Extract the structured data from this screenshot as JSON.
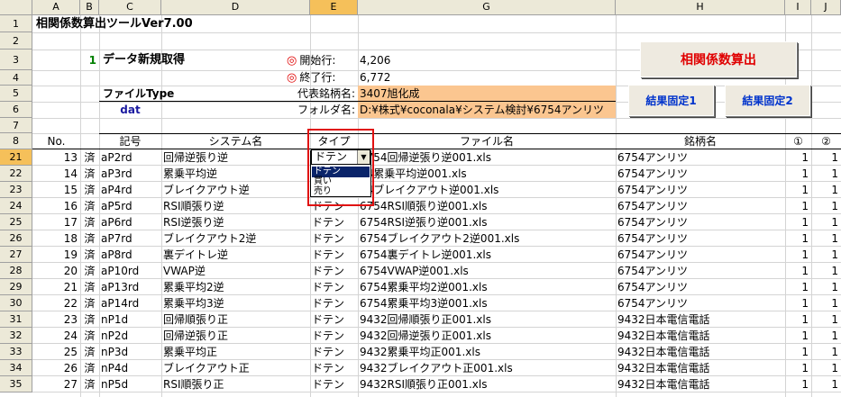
{
  "columns": [
    "A",
    "B",
    "C",
    "D",
    "E",
    "G",
    "H",
    "I",
    "J"
  ],
  "selected_column": "E",
  "title": "相関係数算出ツールVer7.00",
  "top_rows": [
    "1",
    "2",
    "3",
    "4",
    "5",
    "6",
    "7",
    "8"
  ],
  "data_row_numbers": [
    "21",
    "22",
    "23",
    "24",
    "25",
    "26",
    "27",
    "28",
    "29",
    "30",
    "31",
    "32",
    "33",
    "34",
    "35"
  ],
  "selected_row": "21",
  "step_number": "1",
  "data_refresh_label": "データ新規取得",
  "circle_mark": "◎",
  "start_row_label": "開始行:",
  "start_row_value": "4,206",
  "end_row_label": "終了行:",
  "end_row_value": "6,772",
  "file_type_label": "ファイルType",
  "file_type_value": "dat",
  "rep_stock_label": "代表銘柄名:",
  "rep_stock_value": "3407旭化成",
  "folder_label": "フォルダ名:",
  "folder_value": "D:¥株式¥coconala¥システム検討¥6754アンリツ",
  "buttons": {
    "calc": "相関係数算出",
    "fix1": "結果固定1",
    "fix2": "結果固定2"
  },
  "table_headers": {
    "no": "No.",
    "symbol": "記号",
    "system": "システム名",
    "type": "タイプ",
    "file": "ファイル名",
    "stock": "銘柄名",
    "c1": "①",
    "c2": "②"
  },
  "dropdown": {
    "value": "ドテン",
    "options": [
      "ドテン",
      "買い",
      "売り"
    ],
    "selected_index": 0
  },
  "rows": [
    {
      "no": "13",
      "b": "済",
      "sym": "aP2rd",
      "sys": "回帰逆張り逆",
      "type": "",
      "file": "6754回帰逆張り逆001.xls",
      "stock": "6754アンリツ",
      "c1": "1",
      "c2": "1"
    },
    {
      "no": "14",
      "b": "済",
      "sym": "aP3rd",
      "sys": "累乗平均逆",
      "type": "",
      "file": "54累乗平均逆001.xls",
      "stock": "6754アンリツ",
      "c1": "1",
      "c2": "1"
    },
    {
      "no": "15",
      "b": "済",
      "sym": "aP4rd",
      "sys": "ブレイクアウト逆",
      "type": "",
      "file": "54ブレイクアウト逆001.xls",
      "stock": "6754アンリツ",
      "c1": "1",
      "c2": "1"
    },
    {
      "no": "16",
      "b": "済",
      "sym": "aP5rd",
      "sys": "RSI順張り逆",
      "type": "ドテン",
      "file": "6754RSI順張り逆001.xls",
      "stock": "6754アンリツ",
      "c1": "1",
      "c2": "1"
    },
    {
      "no": "17",
      "b": "済",
      "sym": "aP6rd",
      "sys": "RSI逆張り逆",
      "type": "ドテン",
      "file": "6754RSI逆張り逆001.xls",
      "stock": "6754アンリツ",
      "c1": "1",
      "c2": "1"
    },
    {
      "no": "18",
      "b": "済",
      "sym": "aP7rd",
      "sys": "ブレイクアウト2逆",
      "type": "ドテン",
      "file": "6754ブレイクアウト2逆001.xls",
      "stock": "6754アンリツ",
      "c1": "1",
      "c2": "1"
    },
    {
      "no": "19",
      "b": "済",
      "sym": "aP8rd",
      "sys": "裏デイトレ逆",
      "type": "ドテン",
      "file": "6754裏デイトレ逆001.xls",
      "stock": "6754アンリツ",
      "c1": "1",
      "c2": "1"
    },
    {
      "no": "20",
      "b": "済",
      "sym": "aP10rd",
      "sys": "VWAP逆",
      "type": "ドテン",
      "file": "6754VWAP逆001.xls",
      "stock": "6754アンリツ",
      "c1": "1",
      "c2": "1"
    },
    {
      "no": "21",
      "b": "済",
      "sym": "aP13rd",
      "sys": "累乗平均2逆",
      "type": "ドテン",
      "file": "6754累乗平均2逆001.xls",
      "stock": "6754アンリツ",
      "c1": "1",
      "c2": "1"
    },
    {
      "no": "22",
      "b": "済",
      "sym": "aP14rd",
      "sys": "累乗平均3逆",
      "type": "ドテン",
      "file": "6754累乗平均3逆001.xls",
      "stock": "6754アンリツ",
      "c1": "1",
      "c2": "1"
    },
    {
      "no": "23",
      "b": "済",
      "sym": "nP1d",
      "sys": "回帰順張り正",
      "type": "ドテン",
      "file": "9432回帰順張り正001.xls",
      "stock": "9432日本電信電話",
      "c1": "1",
      "c2": "1"
    },
    {
      "no": "24",
      "b": "済",
      "sym": "nP2d",
      "sys": "回帰逆張り正",
      "type": "ドテン",
      "file": "9432回帰逆張り正001.xls",
      "stock": "9432日本電信電話",
      "c1": "1",
      "c2": "1"
    },
    {
      "no": "25",
      "b": "済",
      "sym": "nP3d",
      "sys": "累乗平均正",
      "type": "ドテン",
      "file": "9432累乗平均正001.xls",
      "stock": "9432日本電信電話",
      "c1": "1",
      "c2": "1"
    },
    {
      "no": "26",
      "b": "済",
      "sym": "nP4d",
      "sys": "ブレイクアウト正",
      "type": "ドテン",
      "file": "9432ブレイクアウト正001.xls",
      "stock": "9432日本電信電話",
      "c1": "1",
      "c2": "1"
    },
    {
      "no": "27",
      "b": "済",
      "sym": "nP5d",
      "sys": "RSI順張り正",
      "type": "ドテン",
      "file": "9432RSI順張り正001.xls",
      "stock": "9432日本電信電話",
      "c1": "1",
      "c2": "1"
    }
  ]
}
